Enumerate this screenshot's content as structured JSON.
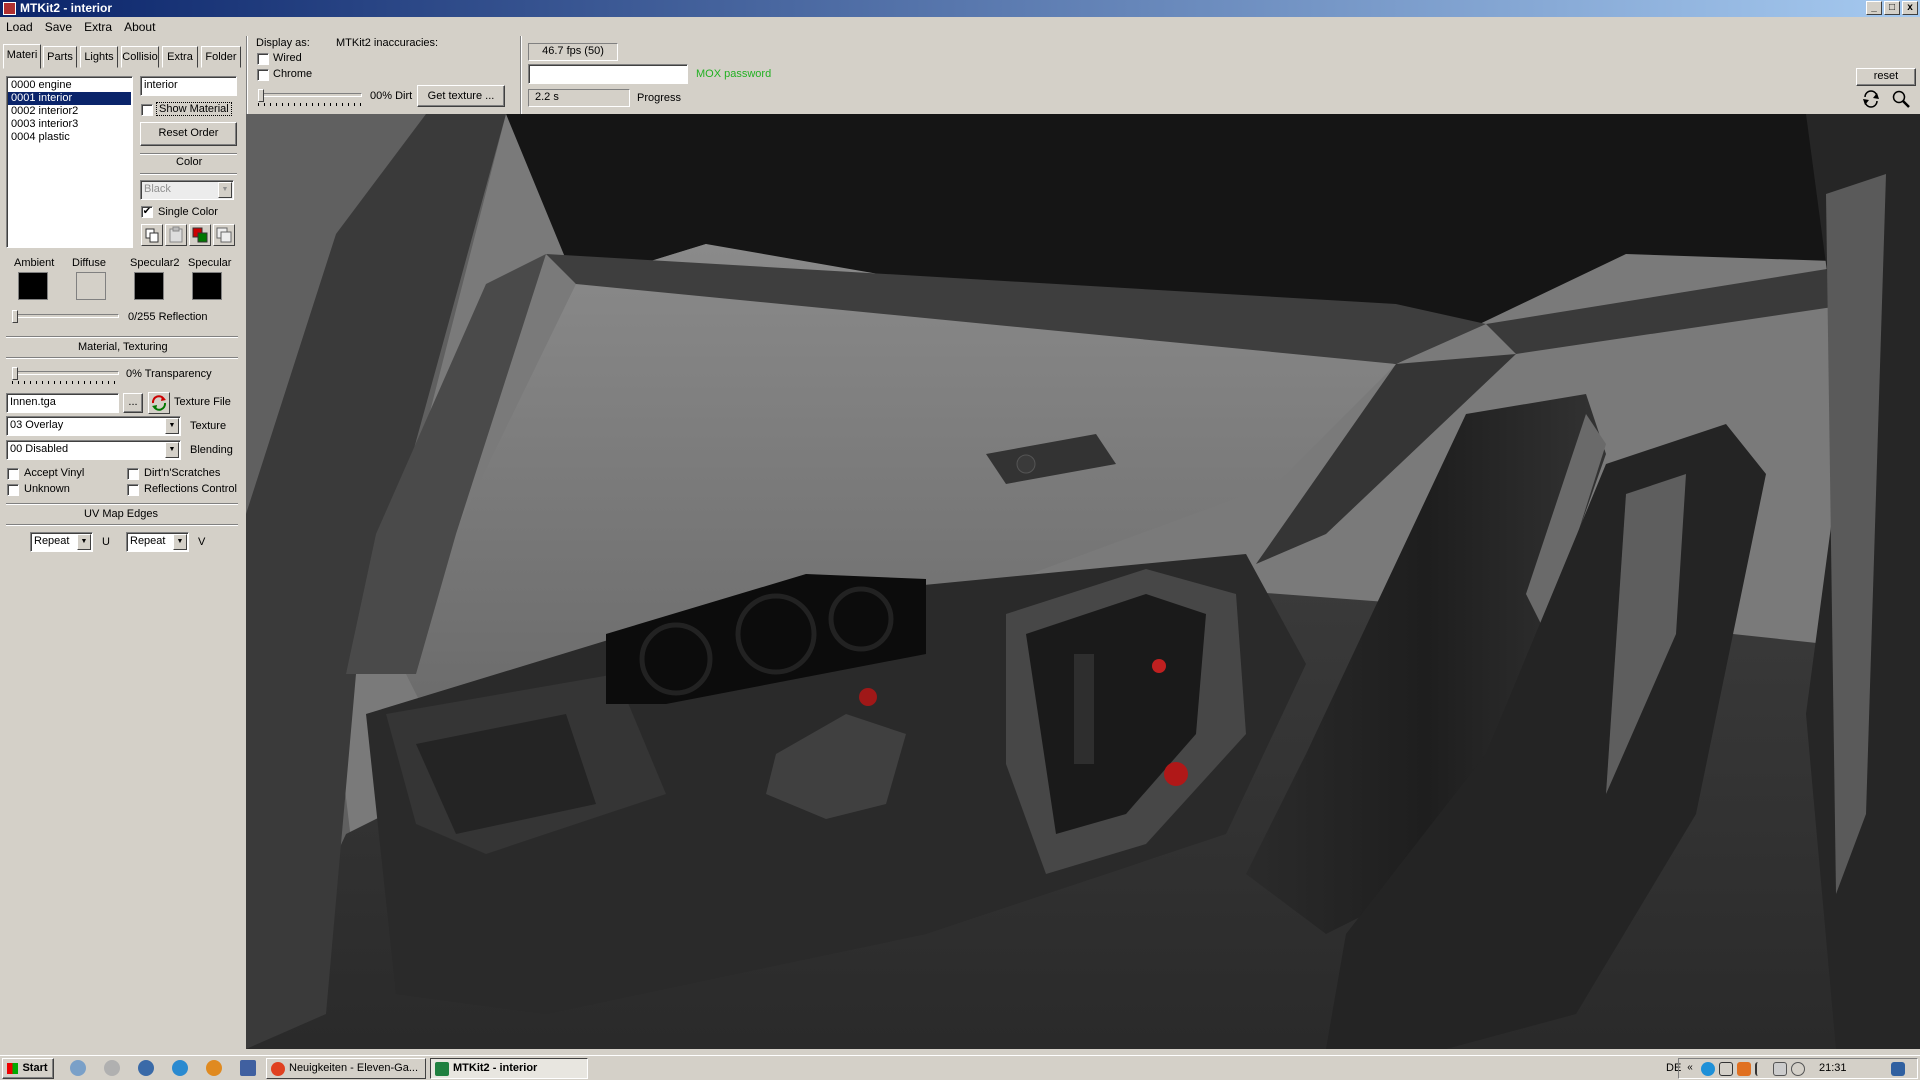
{
  "window": {
    "title": "MTKit2 - interior",
    "controls": {
      "minimize": "_",
      "maximize": "□",
      "close": "x"
    }
  },
  "menu": [
    "Load",
    "Save",
    "Extra",
    "About"
  ],
  "tabs": [
    "Materi",
    "Parts",
    "Lights",
    "Collisio",
    "Extra",
    "Folder"
  ],
  "materials": {
    "items": [
      "0000 engine",
      "0001 interior",
      "0002 interior2",
      "0003 interior3",
      "0004 plastic"
    ],
    "selected_index": 1,
    "name_value": "interior",
    "show_material_label": "Show Material",
    "show_material_checked": false,
    "reset_order_label": "Reset Order",
    "color_label": "Color",
    "color_value": "Black",
    "single_color_label": "Single Color",
    "single_color_checked": true
  },
  "color_swatches": [
    {
      "label": "Ambient",
      "color": "#000000"
    },
    {
      "label": "Diffuse",
      "color": "#d4d0c8"
    },
    {
      "label": "Specular2",
      "color": "#000000"
    },
    {
      "label": "Specular",
      "color": "#000000"
    }
  ],
  "reflection": {
    "text": "0/255 Reflection",
    "value": 0,
    "max": 255
  },
  "material_texturing_label": "Material, Texturing",
  "transparency": {
    "text": "0% Transparency",
    "value": 0
  },
  "texture_file": {
    "value": "Innen.tga",
    "browse_label": "...",
    "label": "Texture File"
  },
  "texture": {
    "value": "03 Overlay",
    "label": "Texture"
  },
  "blending": {
    "value": "00 Disabled",
    "label": "Blending"
  },
  "flags": [
    {
      "label": "Accept Vinyl",
      "checked": false
    },
    {
      "label": "Dirt'n'Scratches",
      "checked": false
    },
    {
      "label": "Unknown",
      "checked": false
    },
    {
      "label": "Reflections Control",
      "checked": false
    }
  ],
  "uv_map": {
    "title": "UV Map Edges",
    "u_value": "Repeat",
    "u_label": "U",
    "v_value": "Repeat",
    "v_label": "V"
  },
  "display": {
    "label": "Display as:",
    "wired_label": "Wired",
    "wired_checked": false,
    "chrome_label": "Chrome",
    "chrome_checked": false,
    "dirt_text": "00% Dirt",
    "get_texture_label": "Get texture ...",
    "inaccuracies_label": "MTKit2 inaccuracies:"
  },
  "status": {
    "fps": "46.7 fps (50)",
    "password_value": "",
    "mox_password_label": "MOX password",
    "mox_password_color": "#22b022",
    "time": "2.2 s",
    "progress_label": "Progress",
    "progress_value": 0
  },
  "viewport_tools": {
    "reset_label": "reset",
    "rotate": "rotate-icon",
    "zoom": "magnifier-icon"
  },
  "taskbar": {
    "start_label": "Start",
    "tasks": [
      {
        "label": "Neuigkeiten - Eleven-Ga...",
        "active": false
      },
      {
        "label": "MTKit2 - interior",
        "active": true
      }
    ],
    "language": "DE",
    "clock": "21:31"
  }
}
